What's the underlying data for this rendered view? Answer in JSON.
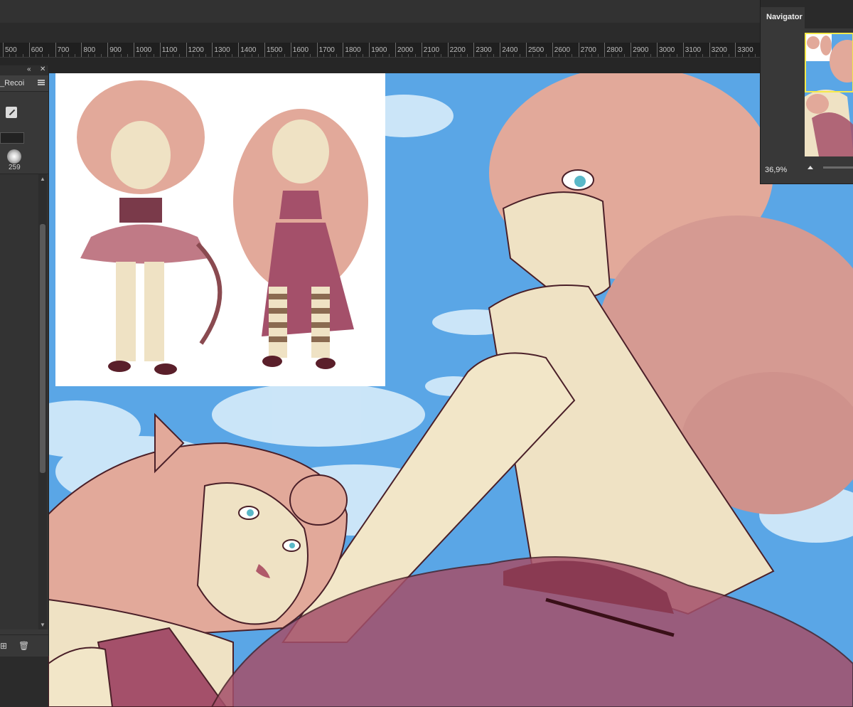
{
  "ruler": {
    "labels": [
      "500",
      "600",
      "700",
      "800",
      "900",
      "1000",
      "1100",
      "1200",
      "1300",
      "1400",
      "1500",
      "1600",
      "1700",
      "1800",
      "1900",
      "2000",
      "2100",
      "2200",
      "2300",
      "2400",
      "2500",
      "2600",
      "2700",
      "2800",
      "2900",
      "3000",
      "3100",
      "3200",
      "3300"
    ]
  },
  "layers_panel": {
    "collapse_icon": "double-chevron-left-icon",
    "close_icon": "close-icon",
    "tab_label": "_Recoi",
    "brush_size": "259"
  },
  "navigator": {
    "tab_label": "Navigator",
    "zoom": "36,9%"
  },
  "colors": {
    "sky": "#5aa6e6",
    "skin": "#efe2c4",
    "hair": "#e2a99a",
    "dress": "#a4506a",
    "outline": "#4a1f28",
    "nav_view_box": "#f5e94a"
  }
}
